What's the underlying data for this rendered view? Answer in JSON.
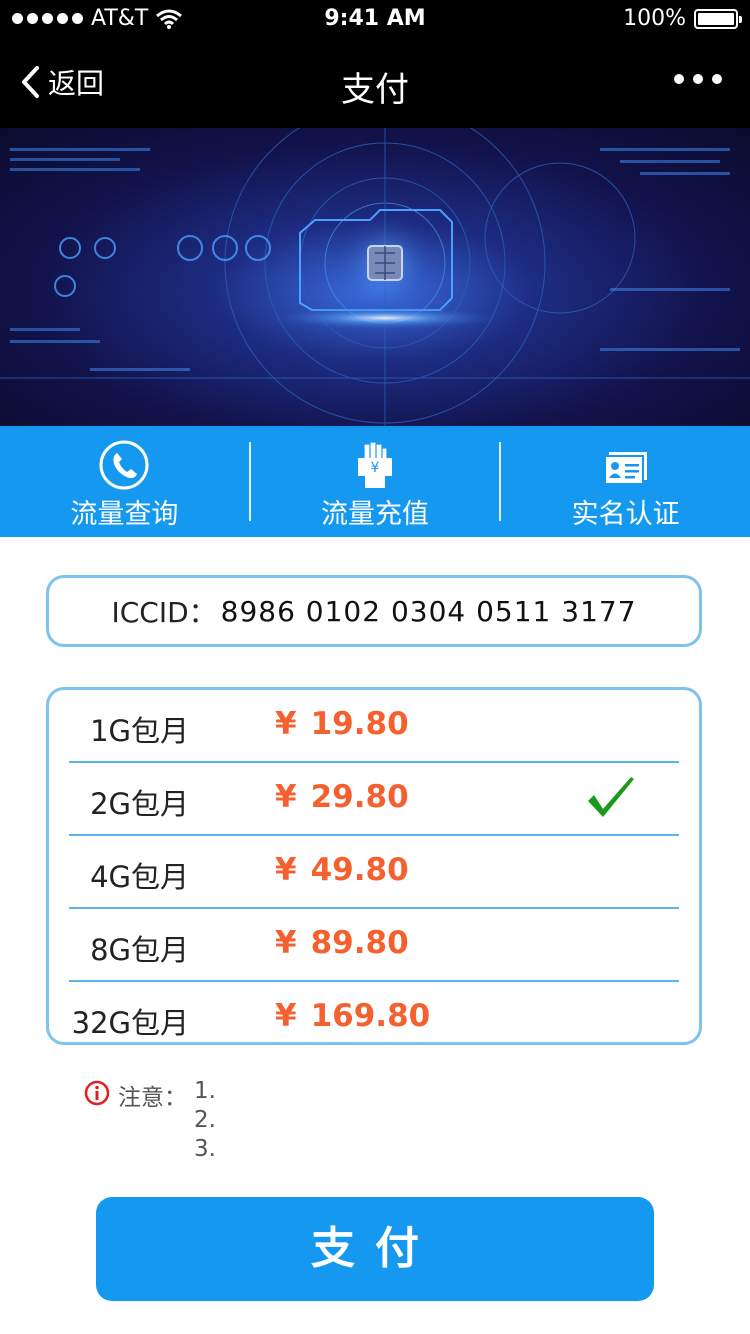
{
  "status_bar": {
    "carrier": "AT&T",
    "time": "9:41 AM",
    "battery": "100%"
  },
  "nav": {
    "back_label": "返回",
    "title": "支付"
  },
  "quick_actions": [
    {
      "label": "流量查询",
      "icon": "phone-icon"
    },
    {
      "label": "流量充值",
      "icon": "hand-yen-icon"
    },
    {
      "label": "实名认证",
      "icon": "id-card-icon"
    }
  ],
  "iccid": {
    "label": "ICCID：",
    "value": "8986 0102 0304 0511 3177"
  },
  "packages": [
    {
      "name": "1G包月",
      "currency": "¥",
      "price": "19.80",
      "selected": false
    },
    {
      "name": "2G包月",
      "currency": "¥",
      "price": "29.80",
      "selected": true
    },
    {
      "name": "4G包月",
      "currency": "¥",
      "price": "49.80",
      "selected": false
    },
    {
      "name": "8G包月",
      "currency": "¥",
      "price": "89.80",
      "selected": false
    },
    {
      "name": "32G包月",
      "currency": "¥",
      "price": "169.80",
      "selected": false
    }
  ],
  "notes": {
    "label": "注意：",
    "lines": [
      "1.",
      "2.",
      "3."
    ]
  },
  "pay_button": {
    "label": "支付"
  },
  "colors": {
    "primary": "#1599f0",
    "price": "#f5602f",
    "border": "#7cc4ee",
    "check": "#1a9a1a",
    "warning": "#e02020"
  }
}
